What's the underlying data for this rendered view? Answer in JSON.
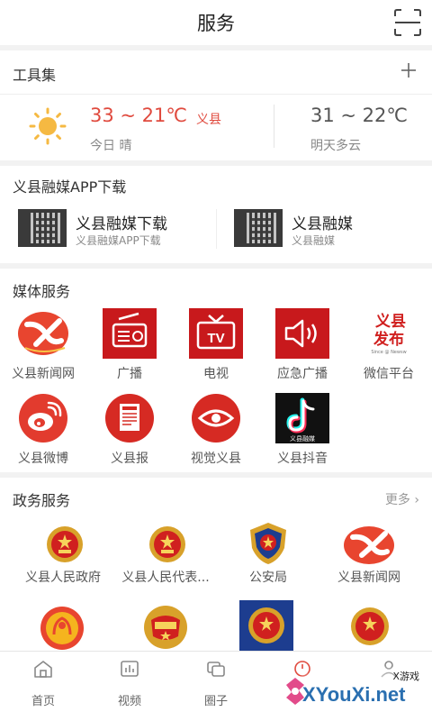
{
  "header": {
    "title": "服务",
    "scan_icon": "scan-icon"
  },
  "tools": {
    "title": "工具集",
    "add_icon": "plus-icon",
    "today": {
      "temp": "33 ~ 21℃",
      "location": "义县",
      "desc": "今日 晴",
      "icon": "sun-icon"
    },
    "tomorrow": {
      "temp": "31 ~ 22℃",
      "desc": "明天多云"
    }
  },
  "app_download": {
    "title": "义县融媒APP下载",
    "items": [
      {
        "name": "义县融媒下载",
        "sub": "义县融媒APP下载"
      },
      {
        "name": "义县融媒",
        "sub": "义县融媒"
      }
    ]
  },
  "media": {
    "title": "媒体服务",
    "items": [
      {
        "label": "义县新闻网",
        "icon": "yixian-news-icon"
      },
      {
        "label": "广播",
        "icon": "radio-icon"
      },
      {
        "label": "电视",
        "icon": "tv-icon"
      },
      {
        "label": "应急广播",
        "icon": "speaker-icon"
      },
      {
        "label": "微信平台",
        "icon": "yixian-fabu-icon",
        "logo_text": [
          "义县",
          "发布"
        ],
        "logo_small": "Since @ Newsw"
      },
      {
        "label": "义县微博",
        "icon": "weibo-icon"
      },
      {
        "label": "义县报",
        "icon": "newspaper-icon"
      },
      {
        "label": "视觉义县",
        "icon": "eye-icon"
      },
      {
        "label": "义县抖音",
        "icon": "douyin-icon",
        "logo_caption": "义县融媒"
      }
    ]
  },
  "gov": {
    "title": "政务服务",
    "more": "更多",
    "items": [
      {
        "label": "义县人民政府",
        "icon": "national-emblem-icon"
      },
      {
        "label": "义县人民代表...",
        "icon": "national-emblem-icon"
      },
      {
        "label": "公安局",
        "icon": "police-emblem-icon"
      },
      {
        "label": "义县新闻网",
        "icon": "yixian-news-icon"
      }
    ],
    "row2": [
      "women-federation-emblem-icon",
      "youth-league-emblem-icon",
      "court-emblem-icon",
      "national-emblem-icon"
    ]
  },
  "nav": {
    "items": [
      {
        "label": "首页",
        "icon": "home-icon"
      },
      {
        "label": "视频",
        "icon": "video-icon"
      },
      {
        "label": "圈子",
        "icon": "circle-icon"
      },
      {
        "label": "",
        "icon": "service-icon"
      },
      {
        "label": "",
        "icon": "user-icon"
      }
    ]
  },
  "watermark": {
    "small": "X游戏",
    "big": "XYouXi.net"
  },
  "colors": {
    "accent": "#e04a3e",
    "brand_red": "#cf1f1f",
    "tab_active": "#e04a3e"
  }
}
